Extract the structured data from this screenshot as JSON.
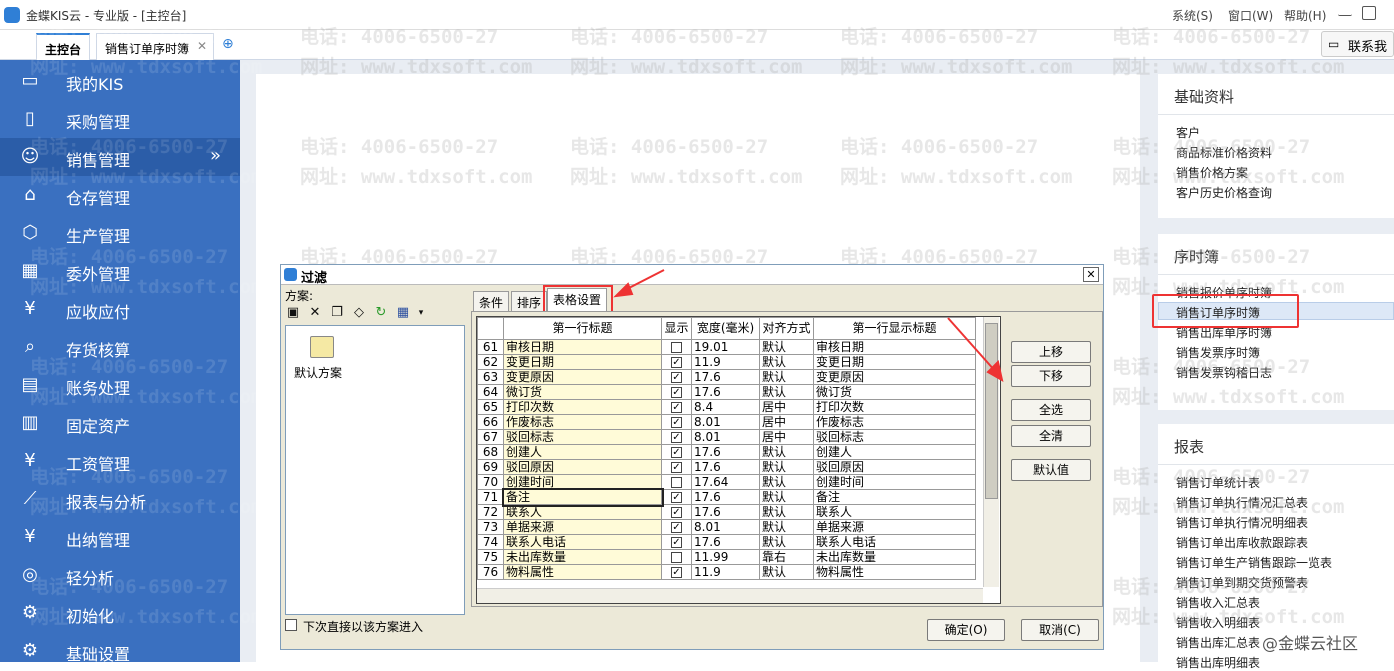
{
  "titlebar": {
    "title": "金蝶KIS云 - 专业版 - [主控台]",
    "menu_system": "系统(S)",
    "menu_window": "窗口(W)",
    "menu_help": "帮助(H)"
  },
  "tabs": [
    {
      "label": "主控台"
    },
    {
      "label": "销售订单序时簿"
    }
  ],
  "contact_label": "联系我",
  "sidebar": {
    "items": [
      {
        "label": "我的KIS",
        "icon": "monitor-icon"
      },
      {
        "label": "采购管理",
        "icon": "cart-icon"
      },
      {
        "label": "销售管理",
        "icon": "users-icon"
      },
      {
        "label": "仓存管理",
        "icon": "warehouse-icon"
      },
      {
        "label": "生产管理",
        "icon": "hexagon-icon"
      },
      {
        "label": "委外管理",
        "icon": "grid-icon"
      },
      {
        "label": "应收应付",
        "icon": "yen-icon"
      },
      {
        "label": "存货核算",
        "icon": "search-home-icon"
      },
      {
        "label": "账务处理",
        "icon": "ledger-icon"
      },
      {
        "label": "固定资产",
        "icon": "building-icon"
      },
      {
        "label": "工资管理",
        "icon": "salary-icon"
      },
      {
        "label": "报表与分析",
        "icon": "chart-icon"
      },
      {
        "label": "出纳管理",
        "icon": "cash-icon"
      },
      {
        "label": "轻分析",
        "icon": "analysis-icon"
      },
      {
        "label": "初始化",
        "icon": "gear-icon"
      },
      {
        "label": "基础设置",
        "icon": "settings-icon"
      }
    ],
    "expand_glyph": "»"
  },
  "panels": {
    "basic": {
      "title": "基础资料",
      "links": [
        "客户",
        "商品标准价格资料",
        "销售价格方案",
        "客户历史价格查询"
      ]
    },
    "journal": {
      "title": "序时簿",
      "links": [
        "销售报价单序时簿",
        "销售订单序时簿",
        "销售出库单序时簿",
        "销售发票序时簿",
        "销售发票钩稽日志"
      ]
    },
    "reports": {
      "title": "报表",
      "links": [
        "销售订单统计表",
        "销售订单执行情况汇总表",
        "销售订单执行情况明细表",
        "销售订单出库收款跟踪表",
        "销售订单生产销售跟踪一览表",
        "销售订单到期交货预警表",
        "销售收入汇总表",
        "销售收入明细表",
        "销售出库汇总表",
        "销售出库明细表"
      ]
    }
  },
  "watermark": {
    "phone": "电话: 4006-6500-27",
    "site": "网址: www.tdxsoft.com"
  },
  "footer_brand": "@金蝶云社区",
  "dialog": {
    "title": "过滤",
    "scheme_label": "方案:",
    "default_scheme": "默认方案",
    "tabs": [
      "条件",
      "排序",
      "表格设置"
    ],
    "columns": [
      "第一行标题",
      "显示",
      "宽度(毫米)",
      "对齐方式",
      "第一行显示标题"
    ],
    "rows": [
      {
        "n": "61",
        "title": "审核日期",
        "show": false,
        "width": "19.01",
        "align": "默认",
        "display": "审核日期"
      },
      {
        "n": "62",
        "title": "变更日期",
        "show": true,
        "width": "11.9",
        "align": "默认",
        "display": "变更日期"
      },
      {
        "n": "63",
        "title": "变更原因",
        "show": true,
        "width": "17.6",
        "align": "默认",
        "display": "变更原因"
      },
      {
        "n": "64",
        "title": "微订货",
        "show": true,
        "width": "17.6",
        "align": "默认",
        "display": "微订货"
      },
      {
        "n": "65",
        "title": "打印次数",
        "show": true,
        "width": "8.4",
        "align": "居中",
        "display": "打印次数"
      },
      {
        "n": "66",
        "title": "作废标志",
        "show": true,
        "width": "8.01",
        "align": "居中",
        "display": "作废标志"
      },
      {
        "n": "67",
        "title": "驳回标志",
        "show": true,
        "width": "8.01",
        "align": "居中",
        "display": "驳回标志"
      },
      {
        "n": "68",
        "title": "创建人",
        "show": true,
        "width": "17.6",
        "align": "默认",
        "display": "创建人"
      },
      {
        "n": "69",
        "title": "驳回原因",
        "show": true,
        "width": "17.6",
        "align": "默认",
        "display": "驳回原因"
      },
      {
        "n": "70",
        "title": "创建时间",
        "show": false,
        "width": "17.64",
        "align": "默认",
        "display": "创建时间"
      },
      {
        "n": "71",
        "title": "备注",
        "show": true,
        "width": "17.6",
        "align": "默认",
        "display": "备注"
      },
      {
        "n": "72",
        "title": "联系人",
        "show": true,
        "width": "17.6",
        "align": "默认",
        "display": "联系人"
      },
      {
        "n": "73",
        "title": "单据来源",
        "show": true,
        "width": "8.01",
        "align": "默认",
        "display": "单据来源"
      },
      {
        "n": "74",
        "title": "联系人电话",
        "show": true,
        "width": "17.6",
        "align": "默认",
        "display": "联系人电话"
      },
      {
        "n": "75",
        "title": "未出库数量",
        "show": false,
        "width": "11.99",
        "align": "靠右",
        "display": "未出库数量"
      },
      {
        "n": "76",
        "title": "物料属性",
        "show": true,
        "width": "11.9",
        "align": "默认",
        "display": "物料属性"
      }
    ],
    "side_buttons": [
      "上移",
      "下移",
      "全选",
      "全清",
      "默认值"
    ],
    "checkbox_label": "下次直接以该方案进入",
    "ok_label": "确定(O)",
    "cancel_label": "取消(C)"
  }
}
